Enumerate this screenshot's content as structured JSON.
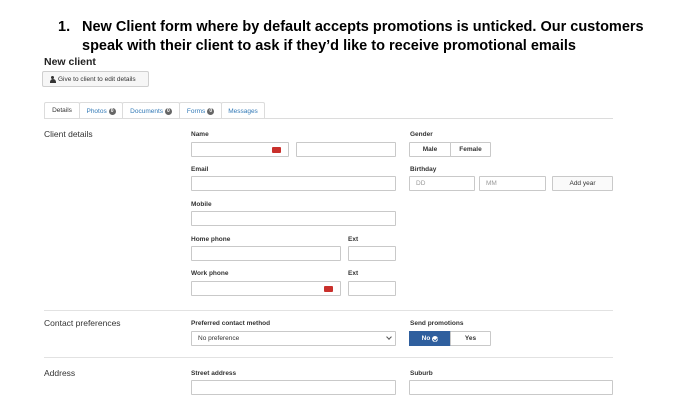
{
  "heading": {
    "number": "1.",
    "line1": "New Client form where by default accepts promotions is unticked.  Our customers",
    "line2": "speak with their client to ask if they’d like to receive promotional emails"
  },
  "page_title": "New client",
  "give_button_label": "Give to client to edit details",
  "tabs": [
    {
      "label": "Details",
      "active": true
    },
    {
      "label": "Photos",
      "badge": "0"
    },
    {
      "label": "Documents",
      "badge": "0"
    },
    {
      "label": "Forms",
      "badge": "0"
    },
    {
      "label": "Messages"
    }
  ],
  "sections": {
    "client_details": "Client details",
    "contact_preferences": "Contact preferences",
    "address": "Address"
  },
  "fields": {
    "name": "Name",
    "email": "Email",
    "mobile": "Mobile",
    "home_phone": "Home phone",
    "home_ext": "Ext",
    "work_phone": "Work phone",
    "work_ext": "Ext",
    "gender": "Gender",
    "gender_male": "Male",
    "gender_female": "Female",
    "birthday": "Birthday",
    "birthday_day_placeholder": "DD",
    "birthday_month_placeholder": "MM",
    "add_year": "Add year",
    "preferred_contact_method": "Preferred contact method",
    "preferred_contact_value": "No preference",
    "send_promotions": "Send promotions",
    "promotions_no": "No",
    "promotions_yes": "Yes",
    "street_address": "Street address",
    "suburb": "Suburb"
  },
  "colors": {
    "link": "#337ab7",
    "primary": "#2f5f9e",
    "required_badge": "#c9302c"
  }
}
